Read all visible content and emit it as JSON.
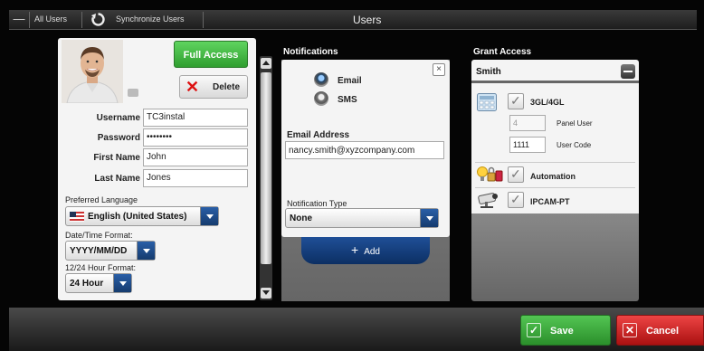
{
  "topbar": {
    "all_users": "All Users",
    "sync_label": "Synchronize Users",
    "title": "Users"
  },
  "user": {
    "full_access_label": "Full Access",
    "delete_label": "Delete",
    "fields": [
      {
        "label": "Username",
        "value": "TC3instal"
      },
      {
        "label": "Password",
        "value": "••••••••"
      },
      {
        "label": "First Name",
        "value": "John"
      },
      {
        "label": "Last Name",
        "value": "Jones"
      }
    ],
    "preferred_language_label": "Preferred Language",
    "preferred_language_value": "English (United States)",
    "date_format_label": "Date/Time Format:",
    "date_format_value": "YYYY/MM/DD",
    "hour_format_label": "12/24 Hour Format:",
    "hour_format_value": "24 Hour"
  },
  "notifications": {
    "title": "Notifications",
    "options": [
      {
        "label": "Email",
        "selected": true
      },
      {
        "label": "SMS",
        "selected": false
      }
    ],
    "email_label": "Email Address",
    "email_value": "nancy.smith@xyzcompany.com",
    "type_label": "Notification Type",
    "type_value": "None",
    "add_label": "Add",
    "close_symbol": "×"
  },
  "grant": {
    "title": "Grant Access",
    "name": "Smith",
    "items": [
      {
        "label": "3GL/4GL",
        "icon": "keypad-icon"
      },
      {
        "label": "Automation",
        "icon": "lightbulb-lock-icon"
      },
      {
        "label": "IPCAM-PT",
        "icon": "camera-icon"
      }
    ],
    "panel_user_value": "4",
    "panel_user_label": "Panel User",
    "user_code_value": "1111",
    "user_code_label": "User Code"
  },
  "footer": {
    "save_label": "Save",
    "cancel_label": "Cancel",
    "save_color": "#3aa83a",
    "cancel_color": "#cc2222"
  }
}
